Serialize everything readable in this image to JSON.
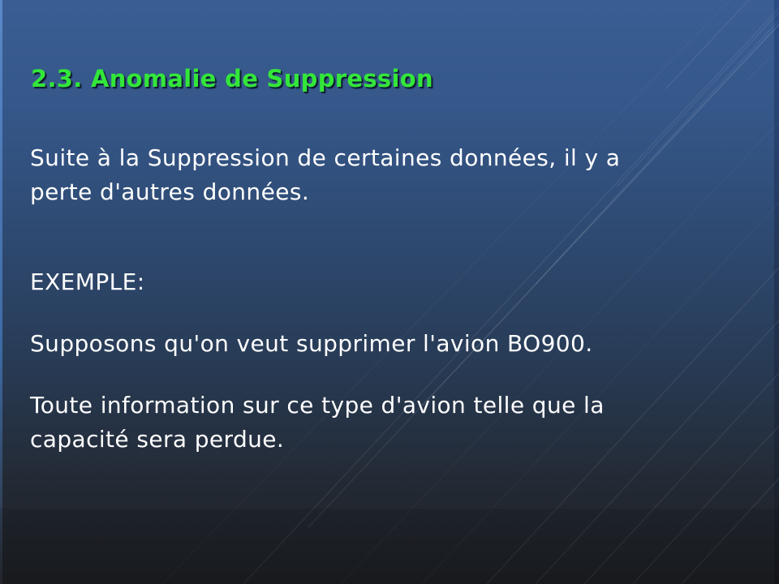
{
  "slide": {
    "title": "2.3. Anomalie de Suppression",
    "paragraph_1": {
      "line_1": "Suite à la Suppression de certaines données, il y a",
      "line_2": "perte d'autres données."
    },
    "example_heading": "EXEMPLE:",
    "example_text": "Supposons qu'on veut supprimer l'avion BO900.",
    "paragraph_2": {
      "line_1": "Toute information sur ce type d'avion telle que la",
      "line_2": "capacité sera perdue."
    }
  },
  "colors": {
    "title": "#33e63a",
    "body_text": "#ffffff",
    "background_top": "#3a5e93",
    "background_bottom": "#1d1f23"
  }
}
